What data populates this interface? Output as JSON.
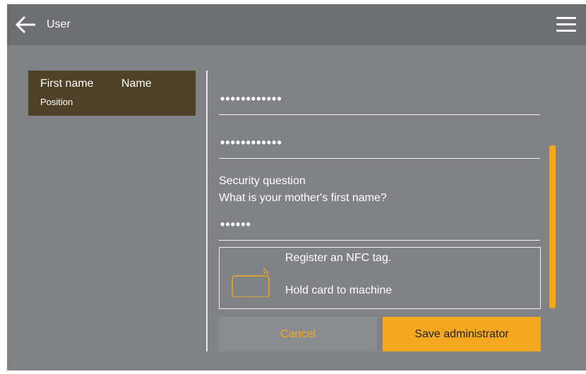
{
  "header": {
    "title": "User",
    "back_icon": "arrow-left-icon",
    "menu_icon": "hamburger-menu-icon"
  },
  "user_card": {
    "first_name": "First name",
    "name": "Name",
    "position": "Position"
  },
  "form": {
    "password": "••••••••••••",
    "password_confirm": "••••••••••••",
    "security_question_label": "Security question",
    "security_question": "What is your mother's first name?",
    "security_answer": "••••••",
    "nfc": {
      "title": "Register an NFC tag.",
      "instruction": "Hold card to machine",
      "icon": "nfc-card-icon"
    }
  },
  "buttons": {
    "cancel": "Cancel",
    "save": "Save administrator"
  },
  "colors": {
    "accent": "#f3a81f",
    "background": "#818285",
    "header": "#6d6e71",
    "user_card": "#4f4127"
  }
}
